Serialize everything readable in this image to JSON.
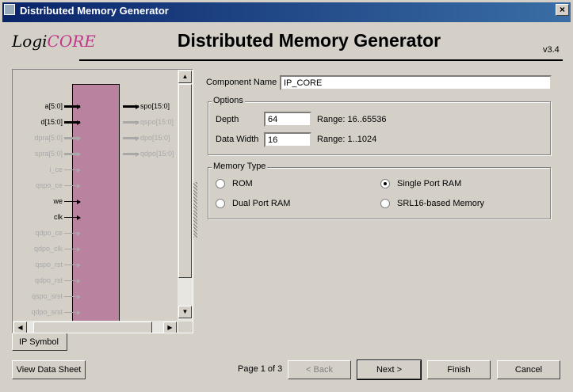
{
  "window": {
    "title": "Distributed Memory Generator",
    "close": "×"
  },
  "header": {
    "logo": "LogiCORE",
    "logo_a": "Logi",
    "logo_b": "CORE",
    "title": "Distributed Memory Generator",
    "version": "v3.4"
  },
  "symbol": {
    "inputs": [
      {
        "label": "a[5:0]",
        "active": true,
        "bus": true
      },
      {
        "label": "d[15:0]",
        "active": true,
        "bus": true
      },
      {
        "label": "dpra[5:0]",
        "active": false,
        "bus": true
      },
      {
        "label": "spra[5:0]",
        "active": false,
        "bus": true
      },
      {
        "label": "i_ce",
        "active": false,
        "bus": false
      },
      {
        "label": "qspo_ce",
        "active": false,
        "bus": false
      },
      {
        "label": "we",
        "active": true,
        "bus": false
      },
      {
        "label": "clk",
        "active": true,
        "bus": false
      },
      {
        "label": "qdpo_ce",
        "active": false,
        "bus": false
      },
      {
        "label": "qdpo_clk",
        "active": false,
        "bus": false
      },
      {
        "label": "qspo_rst",
        "active": false,
        "bus": false
      },
      {
        "label": "qdpo_rst",
        "active": false,
        "bus": false
      },
      {
        "label": "qspo_srst",
        "active": false,
        "bus": false
      },
      {
        "label": "qdpo_srst",
        "active": false,
        "bus": false
      }
    ],
    "outputs": [
      {
        "label": "spo[15:0]",
        "active": true
      },
      {
        "label": "qspo[15:0]",
        "active": false
      },
      {
        "label": "dpo[15:0]",
        "active": false
      },
      {
        "label": "qdpo[15:0]",
        "active": false
      }
    ],
    "tab": "IP Symbol"
  },
  "form": {
    "component_name_label": "Component Name",
    "component_name": "IP_CORE",
    "options_label": "Options",
    "depth_label": "Depth",
    "depth": "64",
    "depth_range": "Range: 16..65536",
    "width_label": "Data Width",
    "width": "16",
    "width_range": "Range: 1..1024",
    "memory_type_label": "Memory Type",
    "memory_types": [
      {
        "label": "ROM",
        "checked": false
      },
      {
        "label": "Single Port RAM",
        "checked": true
      },
      {
        "label": "Dual Port RAM",
        "checked": false
      },
      {
        "label": "SRL16-based Memory",
        "checked": false
      }
    ]
  },
  "footer": {
    "datasheet": "View Data Sheet",
    "page": "Page 1 of 3",
    "back": "< Back",
    "next": "Next >",
    "finish": "Finish",
    "cancel": "Cancel"
  }
}
